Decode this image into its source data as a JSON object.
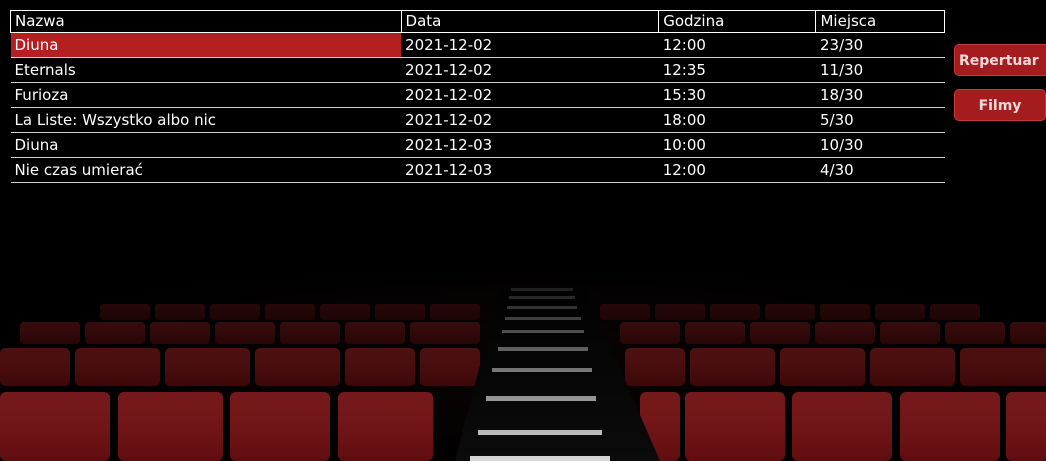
{
  "table": {
    "columns": [
      "Nazwa",
      "Data",
      "Godzina",
      "Miejsca"
    ],
    "rows": [
      {
        "name": "Diuna",
        "date": "2021-12-02",
        "time": "12:00",
        "seats": "23/30"
      },
      {
        "name": "Eternals",
        "date": "2021-12-02",
        "time": "12:35",
        "seats": "11/30"
      },
      {
        "name": "Furioza",
        "date": "2021-12-02",
        "time": "15:30",
        "seats": "18/30"
      },
      {
        "name": "La Liste: Wszystko albo nic",
        "date": "2021-12-02",
        "time": "18:00",
        "seats": "5/30"
      },
      {
        "name": "Diuna",
        "date": "2021-12-03",
        "time": "10:00",
        "seats": "10/30"
      },
      {
        "name": "Nie czas umierać",
        "date": "2021-12-03",
        "time": "12:00",
        "seats": "4/30"
      }
    ],
    "selected_row": 0
  },
  "buttons": {
    "repertoire": "Repertuar",
    "films": "Filmy"
  },
  "colors": {
    "accent": "#b41f21",
    "background": "#000000",
    "seat_red": "#8e1518"
  }
}
